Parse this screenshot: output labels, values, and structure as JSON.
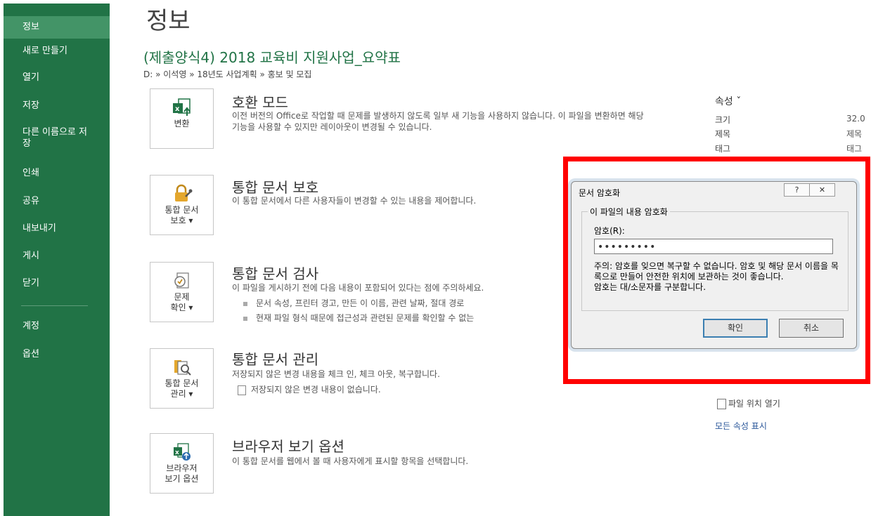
{
  "sidebar": {
    "items": [
      {
        "label": "정보",
        "active": true
      },
      {
        "label": "새로 만들기"
      },
      {
        "label": "열기"
      },
      {
        "label": "저장"
      },
      {
        "label": "다른 이름으로 저장"
      },
      {
        "label": "인쇄"
      },
      {
        "label": "공유"
      },
      {
        "label": "내보내기"
      },
      {
        "label": "게시"
      },
      {
        "label": "닫기"
      },
      {
        "label": "계정"
      },
      {
        "label": "옵션"
      }
    ]
  },
  "page": {
    "title": "정보",
    "doc_title": "(제출양식4) 2018 교육비 지원사업_요약표",
    "path": "D: » 이석영 » 18년도 사업계획 » 홍보 및 모집"
  },
  "sections": {
    "compat": {
      "button_label": "변환",
      "title": "호환 모드",
      "desc": "이전 버전의 Office로 작업할 때 문제를 발생하지 않도록 일부 새 기능을 사용하지 않습니다. 이 파일을 변환하면 해당 기능을 사용할 수 있지만 레이아웃이 변경될 수 있습니다."
    },
    "protect": {
      "button_line1": "통합 문서",
      "button_line2": "보호 ▾",
      "title": "통합 문서 보호",
      "desc": "이 통합 문서에서 다른 사용자들이 변경할 수 있는 내용을 제어합니다."
    },
    "inspect": {
      "button_line1": "문제",
      "button_line2": "확인 ▾",
      "title": "통합 문서 검사",
      "desc": "이 파일을 게시하기 전에 다음 내용이 포함되어 있다는 점에 주의하세요.",
      "bullet1": "문서 속성, 프린터 경고, 만든 이 이름, 관련 날짜, 절대 경로",
      "bullet2": "현재 파일 형식 때문에 접근성과 관련된 문제를 확인할 수 없는"
    },
    "manage": {
      "button_line1": "통합 문서",
      "button_line2": "관리 ▾",
      "title": "통합 문서 관리",
      "desc": "저장되지 않은 변경 내용을 체크 인, 체크 아웃, 복구합니다.",
      "note": "저장되지 않은 변경 내용이 없습니다."
    },
    "browser": {
      "button_line1": "브라우저",
      "button_line2": "보기 옵션",
      "title": "브라우저 보기 옵션",
      "desc": "이 통합 문서를 웹에서 볼 때 사용자에게 표시할 항목을 선택합니다."
    }
  },
  "properties": {
    "heading": "속성 ˇ",
    "size_label": "크기",
    "size_value": "32.0",
    "title_label": "제목",
    "title_value": "제목",
    "tag_label": "태그",
    "tag_value": "태그",
    "open_location": "파일 위치 열기",
    "show_all": "모든 속성 표시"
  },
  "dialog": {
    "title": "문서 암호화",
    "help": "?",
    "close": "✕",
    "group_label": "이 파일의 내용 암호화",
    "password_label": "암호(R):",
    "password_value": "•••••••••",
    "warning": "주의: 암호를 잊으면 복구할 수 없습니다. 암호 및 해당 문서 이름을 목록으로 만들어 안전한 위치에 보관하는 것이 좋습니다.",
    "case_note": "암호는 대/소문자를 구분합니다.",
    "ok": "확인",
    "cancel": "취소"
  },
  "colors": {
    "sidebar": "#217346",
    "highlight": "#ff0000",
    "link": "#2b579a"
  }
}
